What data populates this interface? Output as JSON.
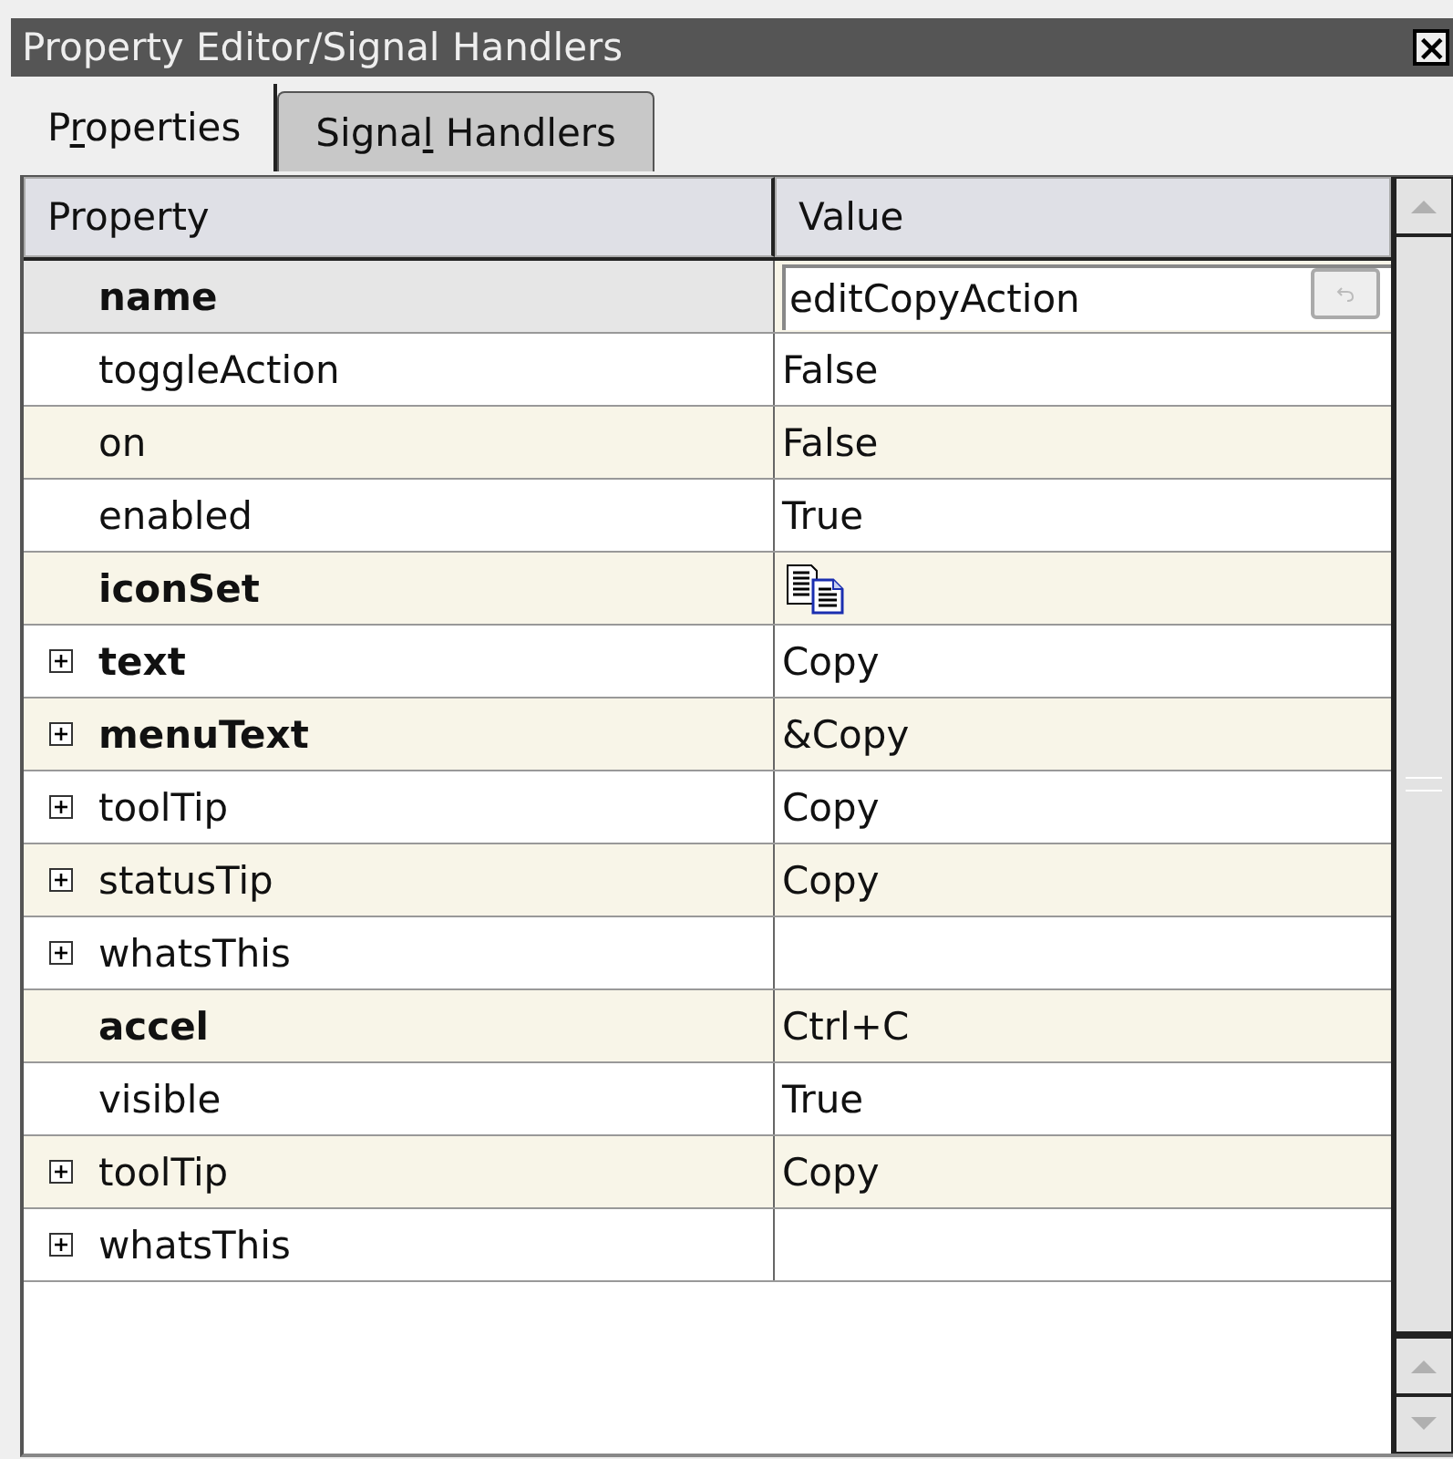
{
  "window": {
    "title": "Property Editor/Signal Handlers",
    "close_glyph": "×"
  },
  "tabs": [
    {
      "label_parts": [
        "P",
        "r",
        "operties"
      ],
      "selected": true
    },
    {
      "label_parts": [
        "Signa",
        "l",
        " Handlers"
      ],
      "selected": false
    }
  ],
  "table": {
    "columns": [
      "Property",
      "Value"
    ],
    "rows": [
      {
        "property": "name",
        "value": "editCopyAction",
        "kind": "editor",
        "changed": true,
        "selected": true
      },
      {
        "property": "toggleAction",
        "value": "False",
        "kind": "text",
        "changed": false,
        "selected": false
      },
      {
        "property": "on",
        "value": "False",
        "kind": "text",
        "changed": false,
        "selected": false
      },
      {
        "property": "enabled",
        "value": "True",
        "kind": "text",
        "changed": false,
        "selected": false
      },
      {
        "property": "iconSet",
        "kind": "icon",
        "changed": true,
        "selected": false
      },
      {
        "property": "text",
        "value": "Copy",
        "kind": "text",
        "changed": true,
        "selected": false,
        "expanded": false
      },
      {
        "property": "menuText",
        "value": "&Copy",
        "kind": "text",
        "changed": true,
        "selected": false,
        "expanded": false
      },
      {
        "property": "toolTip",
        "value": "Copy",
        "kind": "text",
        "changed": false,
        "selected": false,
        "expanded": false
      },
      {
        "property": "statusTip",
        "value": "Copy",
        "kind": "text",
        "changed": false,
        "selected": false,
        "expanded": false
      },
      {
        "property": "whatsThis",
        "kind": "text",
        "changed": false,
        "selected": false,
        "expanded": false
      },
      {
        "property": "accel",
        "value": "Ctrl+C",
        "kind": "text",
        "changed": true,
        "selected": false
      },
      {
        "property": "visible",
        "value": "True",
        "kind": "text",
        "changed": false,
        "selected": false
      },
      {
        "property": "toolTip",
        "value": "Copy",
        "kind": "text",
        "changed": false,
        "selected": false,
        "expanded": false
      },
      {
        "property": "whatsThis",
        "kind": "text",
        "changed": false,
        "selected": false,
        "expanded": false
      }
    ]
  }
}
